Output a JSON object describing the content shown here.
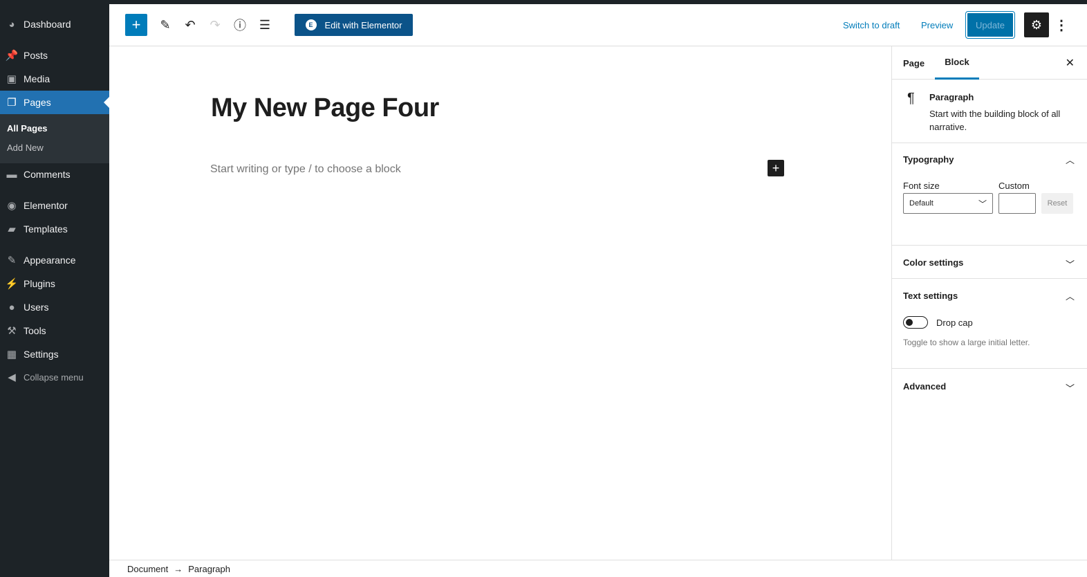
{
  "sidebar": {
    "items": [
      {
        "label": "Dashboard",
        "icon": "dashboard-icon",
        "glyph": "◕"
      },
      {
        "label": "Posts",
        "icon": "pin-icon",
        "glyph": "📌"
      },
      {
        "label": "Media",
        "icon": "media-icon",
        "glyph": "▣"
      },
      {
        "label": "Pages",
        "icon": "pages-icon",
        "glyph": "❐"
      },
      {
        "label": "Comments",
        "icon": "comment-icon",
        "glyph": "▬"
      },
      {
        "label": "Elementor",
        "icon": "elementor-icon",
        "glyph": "◉"
      },
      {
        "label": "Templates",
        "icon": "folder-icon",
        "glyph": "▰"
      },
      {
        "label": "Appearance",
        "icon": "brush-icon",
        "glyph": "✎"
      },
      {
        "label": "Plugins",
        "icon": "plugin-icon",
        "glyph": "⚡"
      },
      {
        "label": "Users",
        "icon": "user-icon",
        "glyph": "●"
      },
      {
        "label": "Tools",
        "icon": "wrench-icon",
        "glyph": "⚒"
      },
      {
        "label": "Settings",
        "icon": "settings-icon",
        "glyph": "▦"
      },
      {
        "label": "Collapse menu",
        "icon": "collapse-icon",
        "glyph": "◀"
      }
    ],
    "submenu": [
      "All Pages",
      "Add New"
    ]
  },
  "toolbar": {
    "edit_elementor": "Edit with Elementor",
    "switch_draft": "Switch to draft",
    "preview": "Preview",
    "update": "Update"
  },
  "editor": {
    "title": "My New Page Four",
    "placeholder": "Start writing or type / to choose a block"
  },
  "panel": {
    "tabs": [
      "Page",
      "Block"
    ],
    "active_tab": "Block",
    "block_name": "Paragraph",
    "block_desc": "Start with the building block of all narrative.",
    "typography": "Typography",
    "font_size_label": "Font size",
    "custom_label": "Custom",
    "font_size_value": "Default",
    "reset": "Reset",
    "color_settings": "Color settings",
    "text_settings": "Text settings",
    "drop_cap": "Drop cap",
    "drop_cap_on": false,
    "drop_cap_help": "Toggle to show a large initial letter.",
    "advanced": "Advanced"
  },
  "breadcrumb": [
    "Document",
    "Paragraph"
  ],
  "colors": {
    "accent": "#007cba",
    "admin_bar": "#1d2327"
  }
}
